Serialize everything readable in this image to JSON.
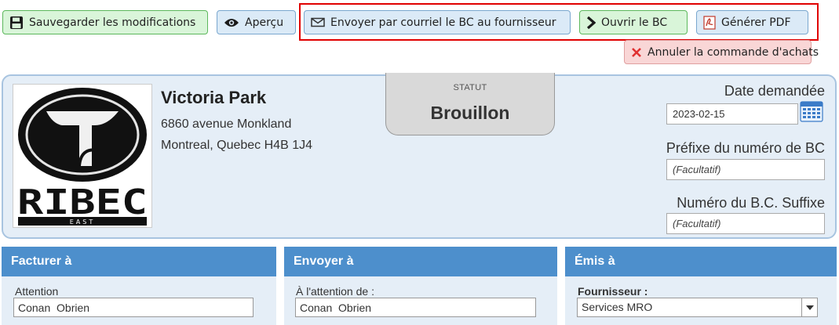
{
  "toolbar": {
    "save_label": "Sauvegarder les modifications",
    "preview_label": "Aperçu",
    "email_label": "Envoyer par courriel le BC au fournisseur",
    "open_label": "Ouvrir le BC",
    "pdf_label": "Générer PDF",
    "cancel_label": "Annuler la commande d'achats"
  },
  "icons": {
    "save": "floppy-disk-icon",
    "preview": "eye-icon",
    "email": "envelope-icon",
    "open": "chevron-right-icon",
    "pdf": "pdf-icon",
    "cancel": "x-icon",
    "calendar": "calendar-icon"
  },
  "company": {
    "logo_text": "RIBEC",
    "logo_subtext": "EAST",
    "name": "Victoria Park",
    "address_line1": "6860 avenue Monkland",
    "address_line2": "Montreal, Quebec H4B 1J4"
  },
  "status": {
    "label": "STATUT",
    "value": "Brouillon"
  },
  "right_fields": {
    "date_label": "Date demandée",
    "date_value": "2023-02-15",
    "prefix_label": "Préfixe du numéro de BC",
    "prefix_placeholder": "(Facultatif)",
    "suffix_label": "Numéro du B.C. Suffixe",
    "suffix_placeholder": "(Facultatif)"
  },
  "sections": {
    "bill_to": {
      "title": "Facturer à",
      "field_label": "Attention",
      "field_value": "Conan  Obrien"
    },
    "ship_to": {
      "title": "Envoyer à",
      "field_label": "À l'attention de :",
      "field_value": "Conan  Obrien"
    },
    "issued_to": {
      "title": "Émis à",
      "field_label": "Fournisseur :",
      "field_value": "Services MRO"
    }
  },
  "colors": {
    "section_header": "#4d8fcc",
    "panel_bg": "#e5eef7",
    "highlight_border": "#e00000",
    "save_button_bg": "#d9f5d9",
    "cancel_button_bg": "#f9d6d6"
  }
}
